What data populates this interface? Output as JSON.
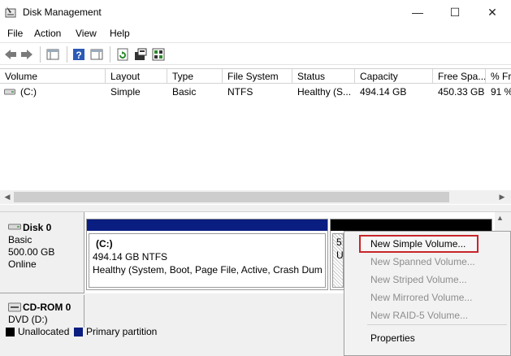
{
  "window": {
    "title": "Disk Management",
    "minimize_glyph": "—",
    "maximize_glyph": "☐",
    "close_glyph": "✕"
  },
  "menu": {
    "items": [
      {
        "label": "File"
      },
      {
        "label": "Action"
      },
      {
        "label": "View"
      },
      {
        "label": "Help"
      }
    ]
  },
  "toolbar": {
    "buttons": [
      "back-icon",
      "forward-icon",
      "console-tree-icon",
      "help-icon",
      "properties-pane-icon",
      "refresh-icon",
      "rescan-icon",
      "settings-icon"
    ]
  },
  "volume_list": {
    "columns": [
      {
        "label": "Volume"
      },
      {
        "label": "Layout"
      },
      {
        "label": "Type"
      },
      {
        "label": "File System"
      },
      {
        "label": "Status"
      },
      {
        "label": "Capacity"
      },
      {
        "label": "Free Spa..."
      },
      {
        "label": "% Fr"
      }
    ],
    "rows": [
      {
        "volume": "(C:)",
        "layout": "Simple",
        "type": "Basic",
        "file_system": "NTFS",
        "status": "Healthy (S...",
        "capacity": "494.14 GB",
        "free_space": "450.33 GB",
        "percent_free": "91 %"
      }
    ]
  },
  "disks": [
    {
      "name": "Disk 0",
      "kind": "Basic",
      "size": "500.00 GB",
      "state": "Online"
    },
    {
      "name": "CD-ROM 0",
      "kind": "DVD (D:)"
    }
  ],
  "partitions": {
    "c": {
      "title": "(C:)",
      "size_fs": "494.14 GB NTFS",
      "status": "Healthy (System, Boot, Page File, Active, Crash Dump,"
    },
    "unallocated": {
      "line1": "5",
      "line2": "U"
    }
  },
  "legend": {
    "unallocated": "Unallocated",
    "primary": "Primary partition",
    "colors": {
      "unallocated": "#000000",
      "primary": "#0a1d80"
    }
  },
  "context_menu": {
    "items": [
      {
        "label": "New Simple Volume...",
        "enabled": true
      },
      {
        "label": "New Spanned Volume...",
        "enabled": false
      },
      {
        "label": "New Striped Volume...",
        "enabled": false
      },
      {
        "label": "New Mirrored Volume...",
        "enabled": false
      },
      {
        "label": "New RAID-5 Volume...",
        "enabled": false
      },
      {
        "label": "Properties",
        "enabled": true
      }
    ],
    "highlight_color": "#c8252b"
  },
  "scroll": {
    "left_arrow": "◀",
    "right_arrow": "▶",
    "up_arrow": "▲"
  }
}
